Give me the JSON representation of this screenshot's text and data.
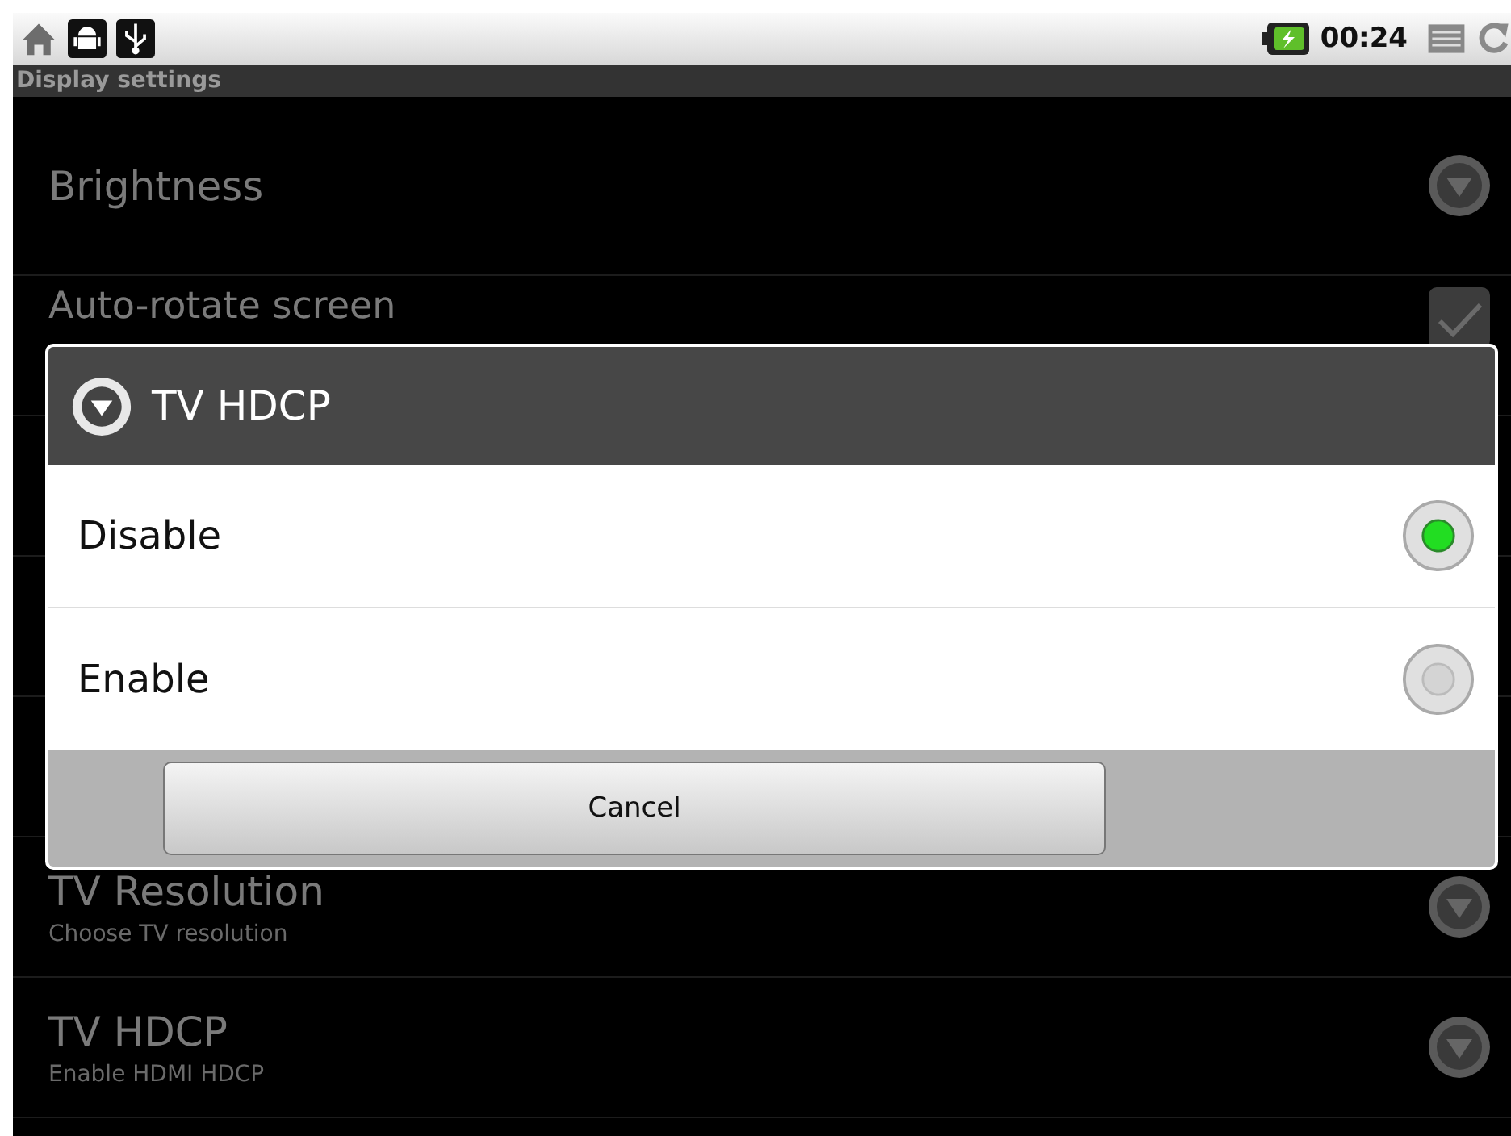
{
  "status_bar": {
    "time": "00:24"
  },
  "title_bar": {
    "title": "Display settings"
  },
  "settings": [
    {
      "kind": "dropdown",
      "title": "Brightness"
    },
    {
      "kind": "checkbox",
      "title": "Auto-rotate screen",
      "checked": true
    },
    {
      "kind": "dropdown",
      "title": "TV Resolution",
      "summary": "Choose TV resolution"
    },
    {
      "kind": "dropdown",
      "title": "TV HDCP",
      "summary": "Enable HDMI HDCP"
    }
  ],
  "dialog": {
    "title": "TV HDCP",
    "options": [
      {
        "label": "Disable",
        "selected": true
      },
      {
        "label": "Enable",
        "selected": false
      }
    ],
    "cancel": "Cancel"
  }
}
